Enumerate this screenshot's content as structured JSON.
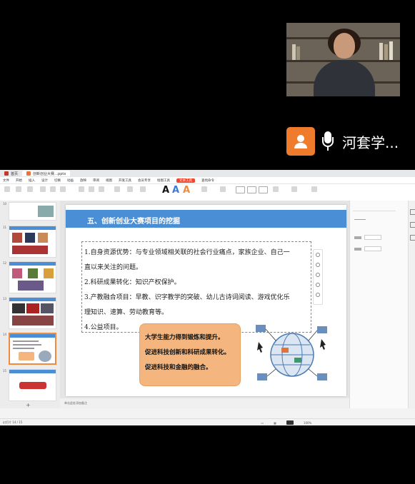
{
  "meeting": {
    "speaker_name": "河套学...",
    "avatar_icon": "person-icon",
    "mic_icon": "microphone-icon",
    "accent": "#ef7b2d"
  },
  "app": {
    "tabs": [
      {
        "label": "首页"
      },
      {
        "label": "创新创业大赛…pptx"
      }
    ],
    "menu": [
      "文件",
      "开始",
      "插入",
      "设计",
      "切换",
      "动画",
      "放映",
      "审阅",
      "视图",
      "开发工具",
      "会员专享",
      "绘图工具",
      "文本工具",
      "查找命令"
    ],
    "menu_highlight": "文本工具",
    "ribbon_font_samples": [
      "A",
      "A",
      "A"
    ]
  },
  "slide": {
    "title": "五、创新创业大赛项目的挖掘",
    "header_color": "#4a8fd6",
    "points": [
      "1.自身资源优势：与专业领域相关联的社会行业痛点，家族企业、自己一",
      "直以来关注的问题。",
      "2.科研成果转化：知识产权保护。",
      "3.产教融合项目：早教、识字教学的突破、幼儿古诗词阅读、游戏优化乐",
      "理知识、速算、劳动教育等。",
      "4.公益项目。"
    ],
    "highlights": [
      "大学生能力得到锻炼和提升。",
      "促进科技创新和科研成果转化。",
      "促进科技和金融的融合。"
    ],
    "highlight_color": "#f4b67e"
  },
  "thumbnails": {
    "numbers": [
      "10",
      "11",
      "12",
      "13",
      "14",
      "15"
    ],
    "selected_index": 4
  },
  "status": {
    "slide_info": "幻灯片 14 / 15",
    "notes_label": "单击此处添加备注",
    "zoom": "100%"
  }
}
